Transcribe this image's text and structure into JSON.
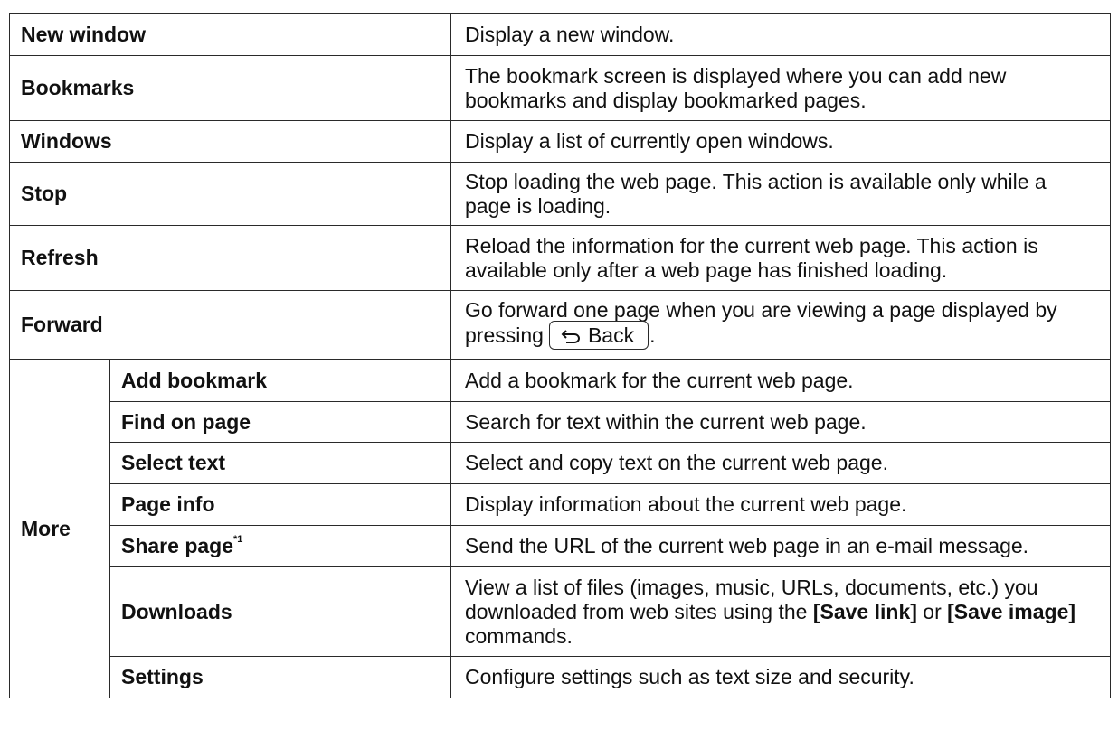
{
  "rows": [
    {
      "label": "New window",
      "desc": "Display a new window."
    },
    {
      "label": "Bookmarks",
      "desc": "The bookmark screen is displayed where you can add new bookmarks and display bookmarked pages."
    },
    {
      "label": "Windows",
      "desc": "Display a list of currently open windows."
    },
    {
      "label": "Stop",
      "desc": "Stop loading the web page. This action is available only while a page is loading."
    },
    {
      "label": "Refresh",
      "desc": "Reload the information for the current web page. This action is available only after a web page has finished loading."
    },
    {
      "label": "Forward",
      "desc_prefix": "Go forward one page when you are viewing a page displayed by pressing",
      "key_label": "Back",
      "key_icon": "back-arrow-icon",
      "desc_suffix": "."
    }
  ],
  "more": {
    "label": "More",
    "items": [
      {
        "label": "Add bookmark",
        "desc": "Add a bookmark for the current web page."
      },
      {
        "label": "Find on page",
        "desc": "Search for text within the current web page."
      },
      {
        "label": "Select text",
        "desc": "Select and copy text on the current web page."
      },
      {
        "label": "Page info",
        "desc": "Display information about the current web page."
      },
      {
        "label": "Share page",
        "footnote": "*1",
        "desc": "Send the URL of the current web page in an e-mail message."
      },
      {
        "label": "Downloads",
        "desc_part1": "View a list of files (images, music, URLs, documents, etc.) you downloaded from web sites using the",
        "cmd1": "[Save link]",
        "desc_part2": "or",
        "cmd2": "[Save image]",
        "desc_part3": "commands."
      },
      {
        "label": "Settings",
        "desc": "Configure settings such as text size and security."
      }
    ]
  }
}
